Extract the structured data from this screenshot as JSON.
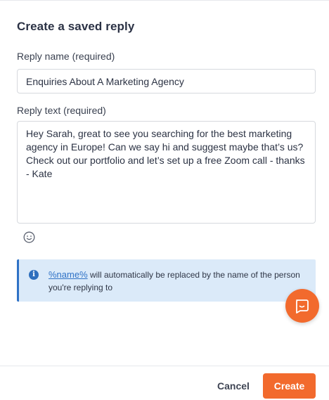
{
  "dialog": {
    "title": "Create a saved reply"
  },
  "reply_name": {
    "label": "Reply name (required)",
    "value": "Enquiries About A Marketing Agency"
  },
  "reply_text": {
    "label": "Reply text (required)",
    "value": "Hey Sarah, great to see you searching for the best marketing agency in Europe! Can we say hi and suggest maybe that’s us? Check out our portfolio and let’s set up a free Zoom call - thanks - Kate"
  },
  "emoji_picker": {
    "icon": "smiley-icon"
  },
  "info": {
    "icon": "info-icon",
    "icon_glyph": "i",
    "token": "%name%",
    "message": " will automatically be replaced by the name of the person you're replying to"
  },
  "chat_launcher": {
    "icon": "chat-bubble-icon",
    "color": "#f26a2d"
  },
  "footer": {
    "cancel_label": "Cancel",
    "create_label": "Create"
  },
  "colors": {
    "accent": "#f26a2d",
    "info_background": "#dbeaf9",
    "info_border": "#2f72c6",
    "link": "#2f72c6"
  }
}
